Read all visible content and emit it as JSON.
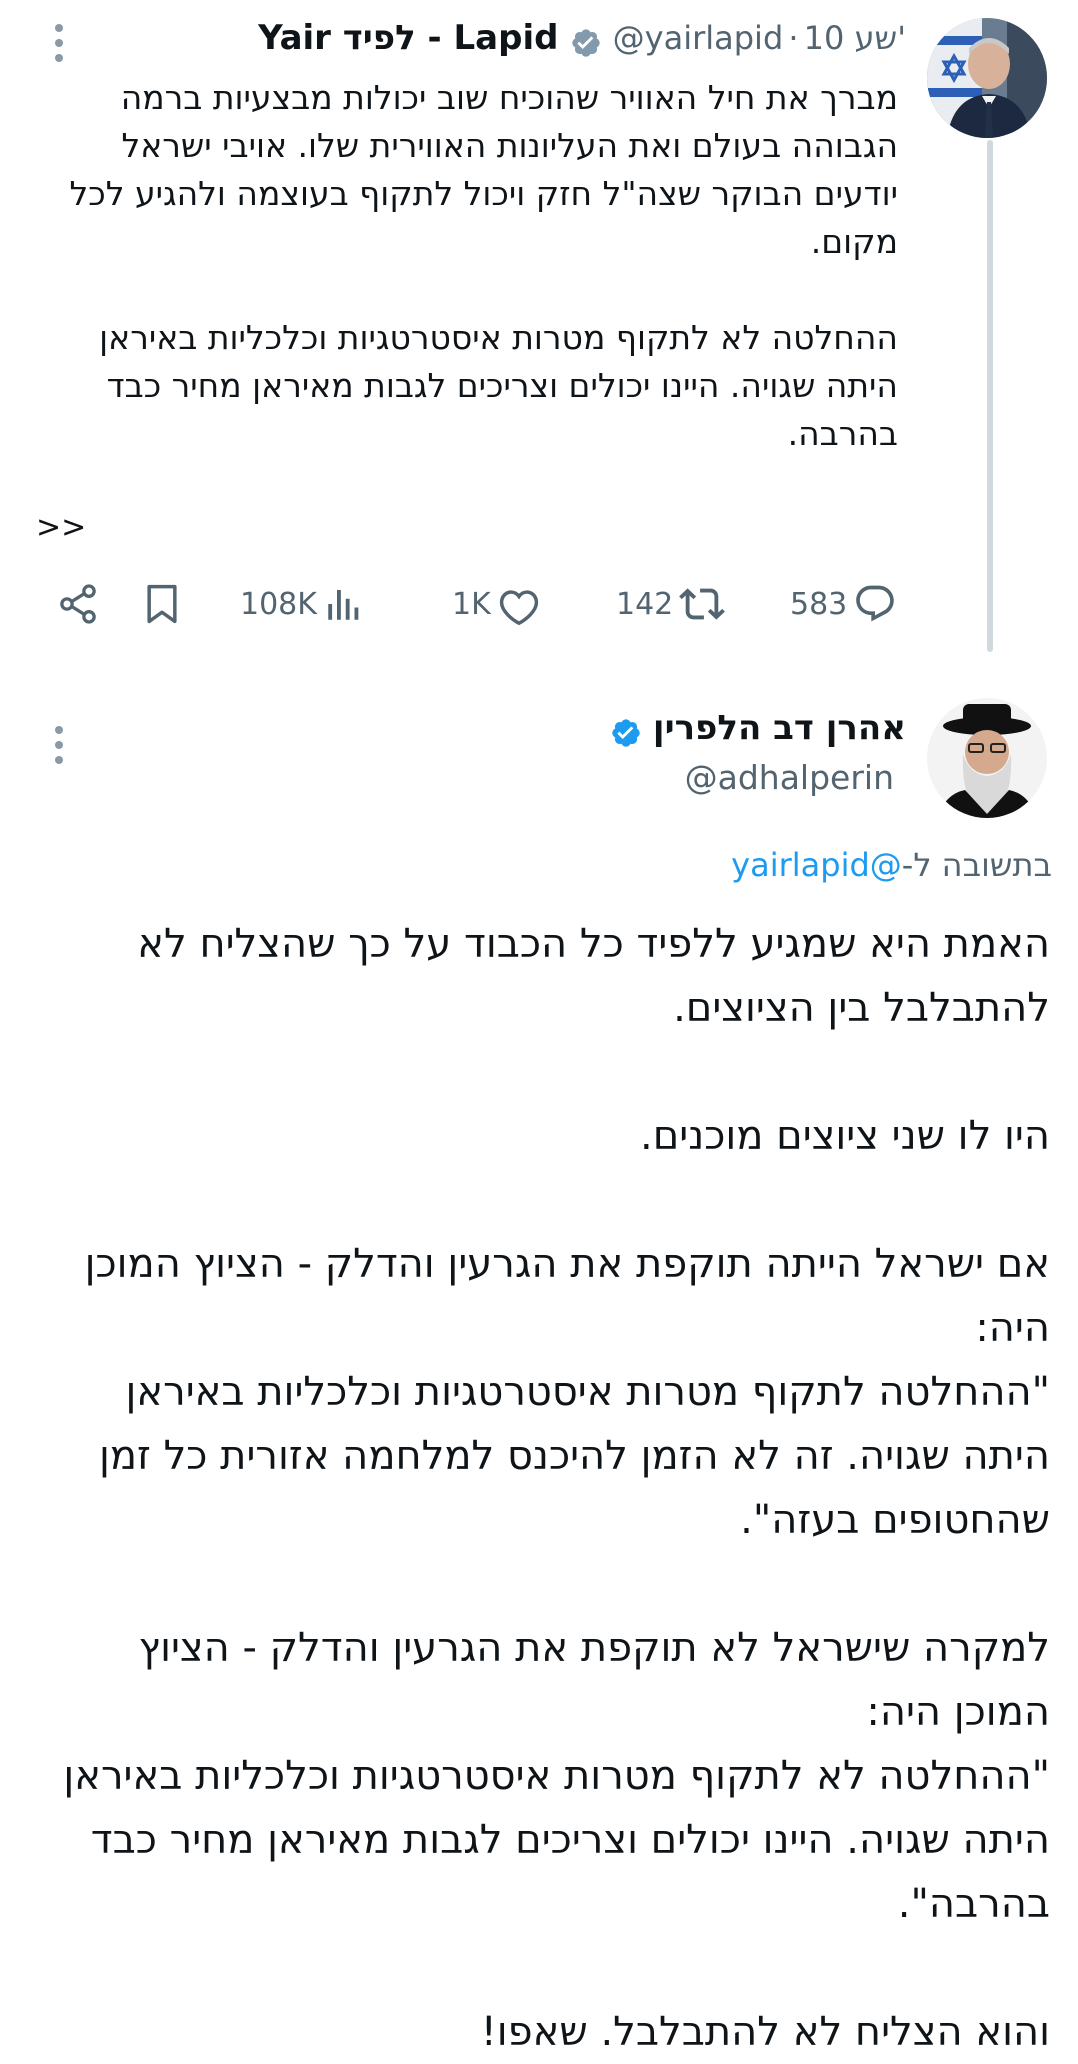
{
  "tweet1": {
    "display_name": "Yair לפיד - Lapid",
    "handle": "@yairlapid",
    "time": "10 שע'",
    "separator": "·",
    "text": "מברך את חיל האוויר שהוכיח שוב יכולות מבצעיות ברמה הגבוהה בעולם ואת העליונות האווירית שלו. אויבי ישראל יודעים הבוקר שצה\"ל חזק ויכול לתקוף בעוצמה ולהגיע לכל מקום.\n\nההחלטה לא לתקוף מטרות איסטרטגיות וכלכליות באיראן היתה שגויה. היינו יכולים וצריכים לגבות מאיראן מחיר כבד בהרבה.",
    "more": ">>",
    "stats": {
      "replies": "583",
      "reposts": "142",
      "likes": "1K",
      "views": "108K"
    }
  },
  "tweet2": {
    "display_name": "אהרן דב הלפרין",
    "handle": "@adhalperin",
    "reply_prefix": "בתשובה ל-",
    "reply_to": "@yairlapid",
    "text": "האמת היא שמגיע ללפיד כל הכבוד על כך שהצליח לא להתבלבל בין הציוצים.\n\nהיו לו שני ציוצים מוכנים.\n\nאם ישראל הייתה תוקפת את הגרעין והדלק - הציוץ המוכן היה:\n\"ההחלטה לתקוף מטרות איסטרטגיות וכלכליות באיראן היתה שגויה. זה לא הזמן להיכנס למלחמה אזורית כל זמן שהחטופים בעזה\".\n\nלמקרה שישראל לא תוקפת את הגרעין והדלק - הציוץ המוכן היה:\n\"ההחלטה לא לתקוף מטרות איסטרטגיות וכלכליות באיראן היתה שגויה. היינו יכולים וצריכים לגבות מאיראן מחיר כבד בהרבה\".\n\nוהוא הצליח לא להתבלבל. שאפו!"
  },
  "icons": {
    "verified": "verified-badge-icon",
    "reply": "reply-icon",
    "repost": "repost-icon",
    "like": "heart-icon",
    "views": "views-icon",
    "bookmark": "bookmark-icon",
    "share": "share-icon",
    "more": "more-vertical-icon"
  },
  "colors": {
    "text": "#0f1419",
    "secondary": "#536471",
    "verified_gray": "#829aab",
    "verified_blue": "#1d9bf0",
    "link": "#1d9bf0",
    "thread_line": "#cfd9de"
  }
}
